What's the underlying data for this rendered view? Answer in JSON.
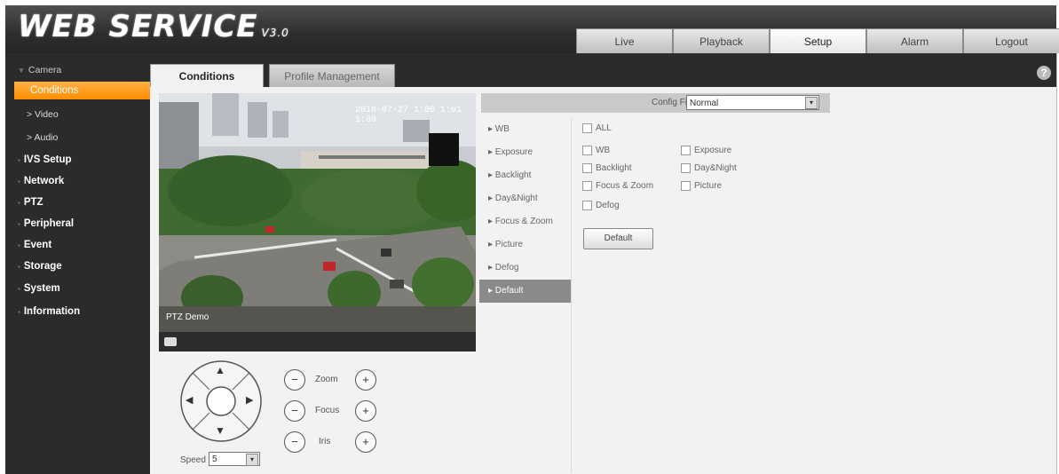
{
  "header": {
    "logo_text": "WEB  SERVICE",
    "logo_version": "V3.0",
    "nav": [
      {
        "label": "Live"
      },
      {
        "label": "Playback"
      },
      {
        "label": "Setup"
      },
      {
        "label": "Alarm"
      },
      {
        "label": "Logout"
      }
    ],
    "active_nav": "Setup"
  },
  "sidebar": {
    "items": [
      {
        "label": "Camera"
      },
      {
        "label": "Conditions"
      },
      {
        "label": "> Video"
      },
      {
        "label": "> Audio"
      },
      {
        "label": "IVS Setup"
      },
      {
        "label": "Network"
      },
      {
        "label": "PTZ"
      },
      {
        "label": "Peripheral"
      },
      {
        "label": "Event"
      },
      {
        "label": "Storage"
      },
      {
        "label": "System"
      },
      {
        "label": "Information"
      }
    ]
  },
  "tabs": {
    "conditions": "Conditions",
    "profile": "Profile Management",
    "help_symbol": "?"
  },
  "video": {
    "timestamp": "2018-07-27 1:00  1:01  1:00",
    "ptz_label": "PTZ Demo"
  },
  "ptz": {
    "zoom_label": "Zoom",
    "focus_label": "Focus",
    "iris_label": "Iris",
    "minus": "−",
    "plus": "+",
    "up": "▲",
    "down": "▼",
    "left": "◀",
    "right": "▶",
    "speed_label": "Speed",
    "speed_value": "5"
  },
  "config": {
    "label": "Config File",
    "value": "Normal",
    "arrow": "▾"
  },
  "menu": [
    {
      "label": "▸  WB"
    },
    {
      "label": "▸  Exposure"
    },
    {
      "label": "▸  Backlight"
    },
    {
      "label": "▸  Day&Night"
    },
    {
      "label": "▸  Focus & Zoom"
    },
    {
      "label": "▸  Picture"
    },
    {
      "label": "▸  Defog"
    },
    {
      "label": "▸  Default"
    }
  ],
  "checkboxes": {
    "all": "ALL",
    "wb": "WB",
    "exposure": "Exposure",
    "backlight": "Backlight",
    "daynight": "Day&Night",
    "focus_zoom": "Focus & Zoom",
    "picture": "Picture",
    "defog": "Defog"
  },
  "default_button": "Default"
}
